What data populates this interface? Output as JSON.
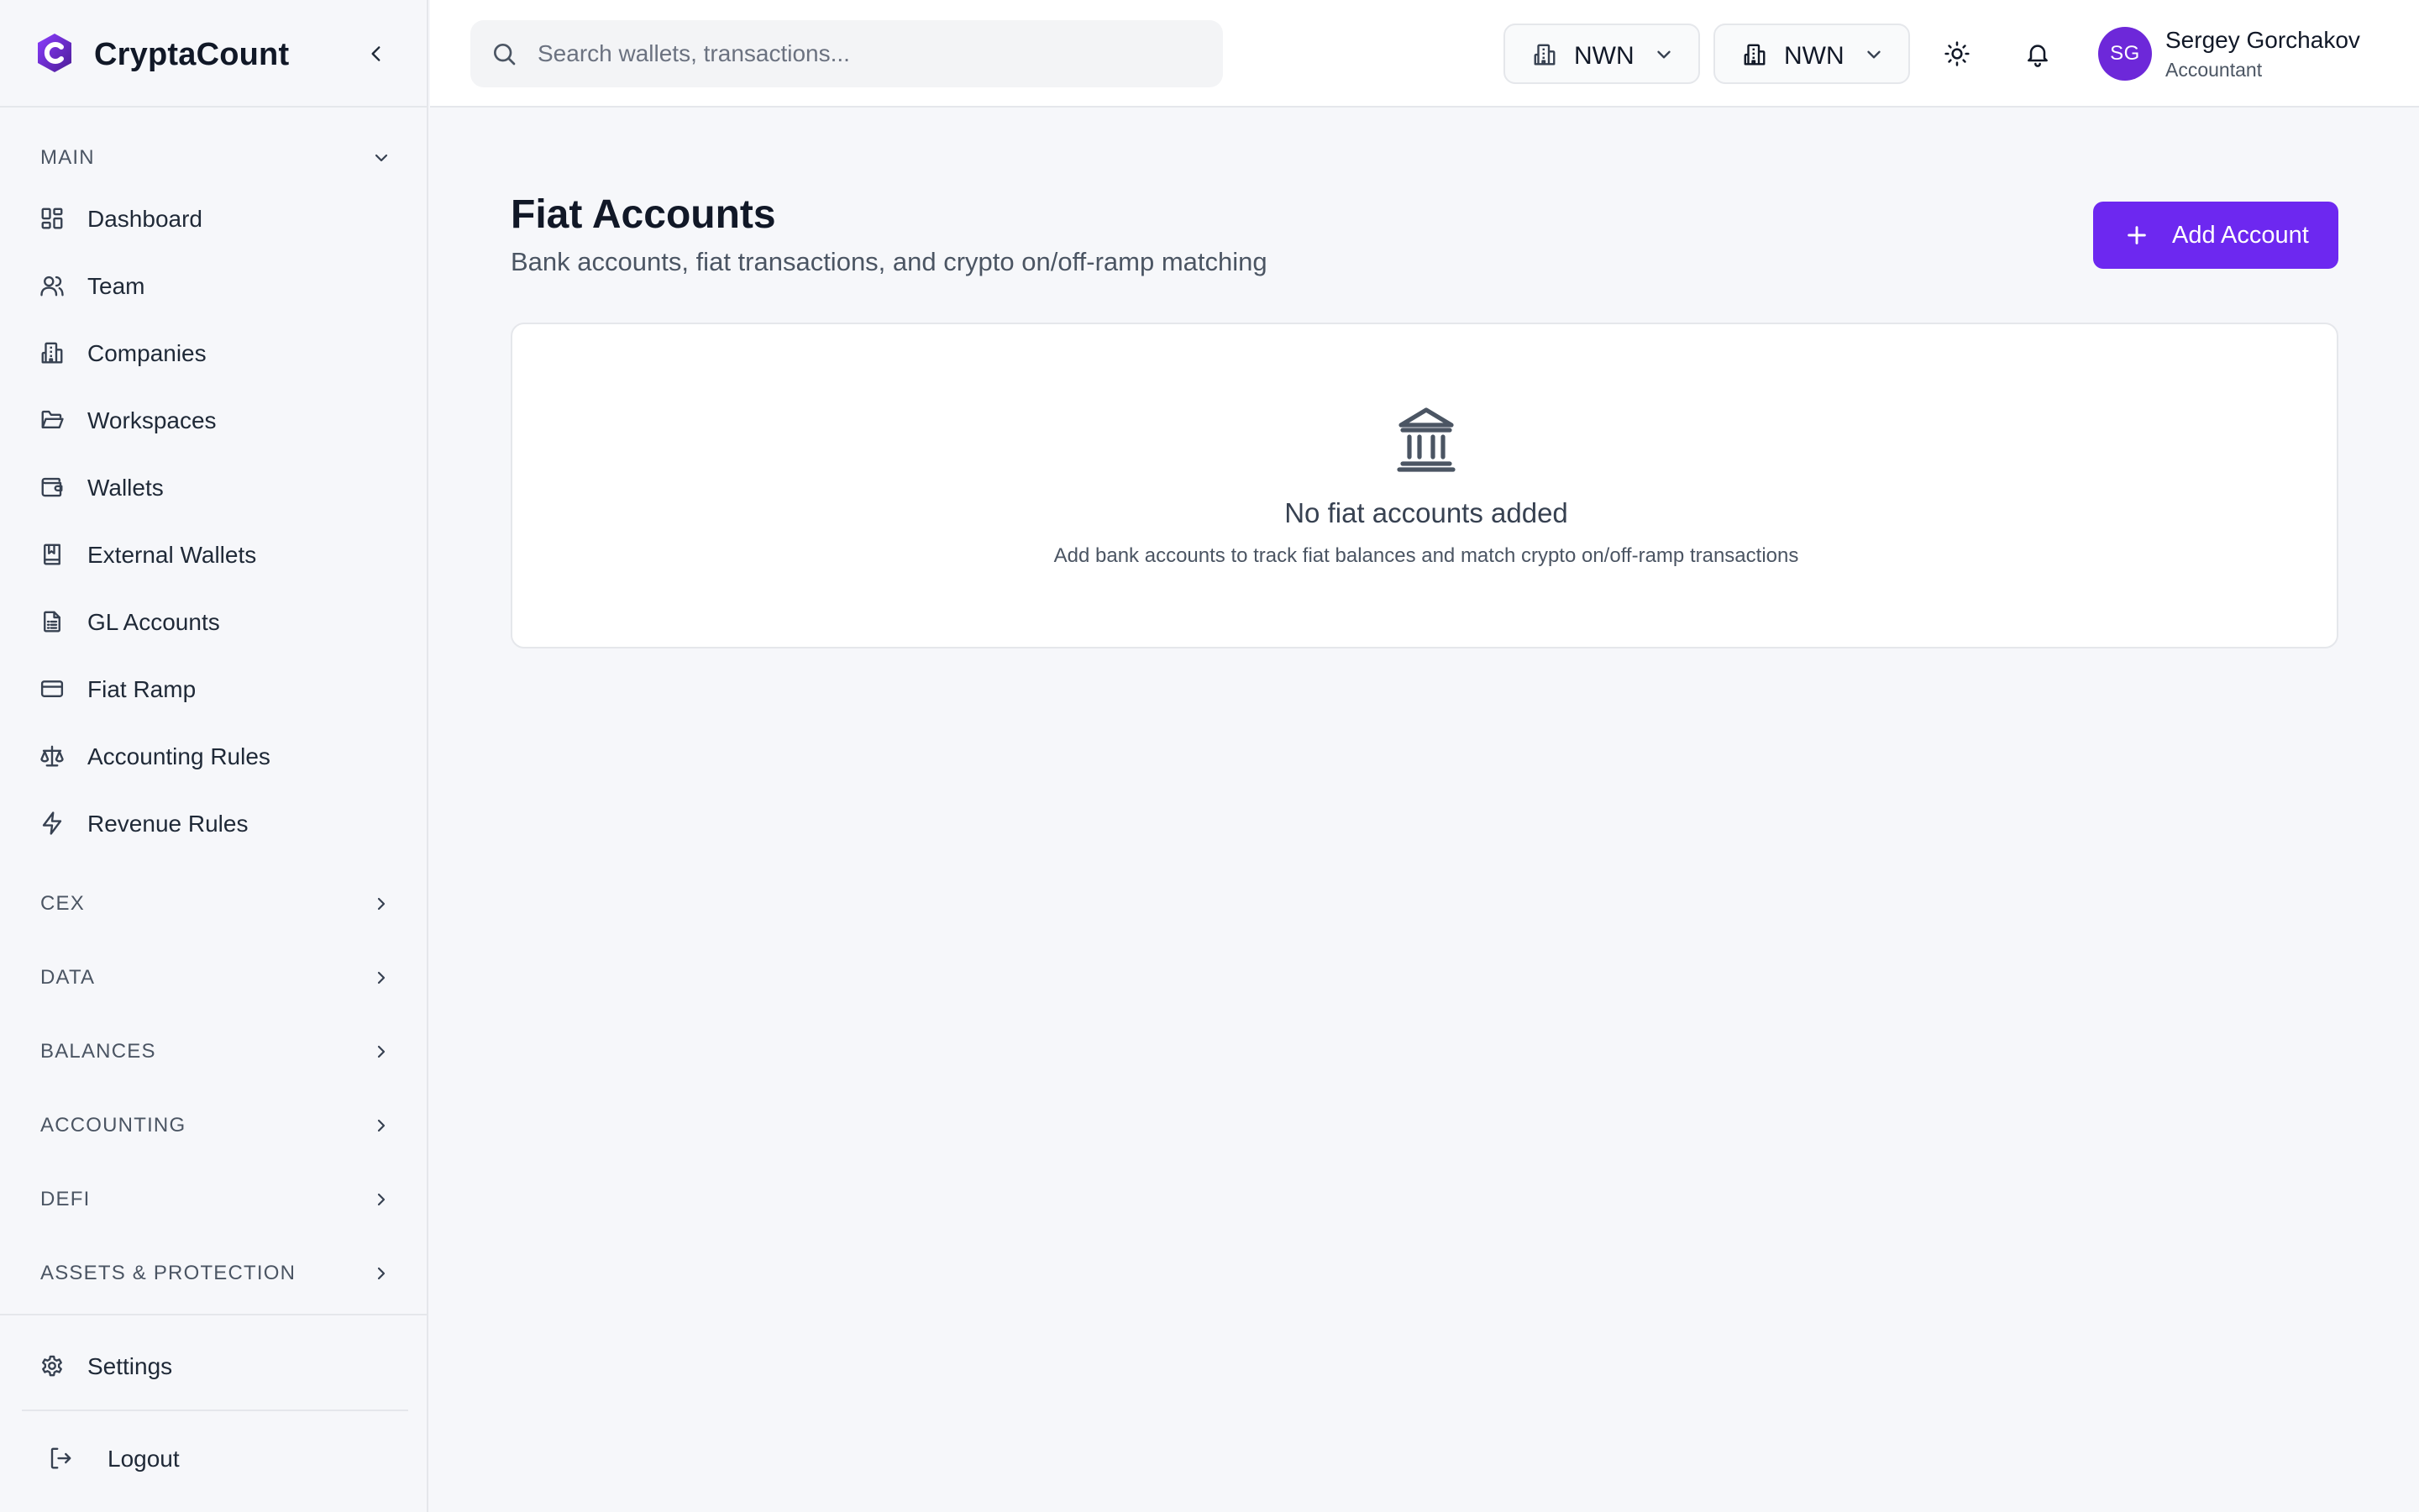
{
  "brand": {
    "name": "CryptaCount"
  },
  "sidebar": {
    "main_section": "MAIN",
    "items": [
      {
        "label": "Dashboard",
        "icon": "dashboard-icon"
      },
      {
        "label": "Team",
        "icon": "users-icon"
      },
      {
        "label": "Companies",
        "icon": "building-icon"
      },
      {
        "label": "Workspaces",
        "icon": "folder-icon"
      },
      {
        "label": "Wallets",
        "icon": "wallet-icon"
      },
      {
        "label": "External Wallets",
        "icon": "book-icon"
      },
      {
        "label": "GL Accounts",
        "icon": "ledger-icon"
      },
      {
        "label": "Fiat Ramp",
        "icon": "credit-card-icon"
      },
      {
        "label": "Accounting Rules",
        "icon": "scale-icon"
      },
      {
        "label": "Revenue Rules",
        "icon": "lightning-icon"
      }
    ],
    "sections": [
      "CEX",
      "DATA",
      "BALANCES",
      "ACCOUNTING",
      "DEFI",
      "ASSETS & PROTECTION"
    ],
    "settings_label": "Settings",
    "logout_label": "Logout"
  },
  "topbar": {
    "search_placeholder": "Search wallets, transactions...",
    "selector_1": "NWN",
    "selector_2": "NWN",
    "user": {
      "initials": "SG",
      "name": "Sergey Gorchakov",
      "role": "Accountant"
    }
  },
  "main": {
    "title": "Fiat Accounts",
    "subtitle": "Bank accounts, fiat transactions, and crypto on/off-ramp matching",
    "add_button": "Add Account",
    "empty": {
      "icon": "bank-icon",
      "title": "No fiat accounts added",
      "description": "Add bank accounts to track fiat balances and match crypto on/off-ramp transactions"
    }
  },
  "colors": {
    "accent": "#6d28f0",
    "avatar": "#6d28d9",
    "background": "#f6f7fa"
  }
}
